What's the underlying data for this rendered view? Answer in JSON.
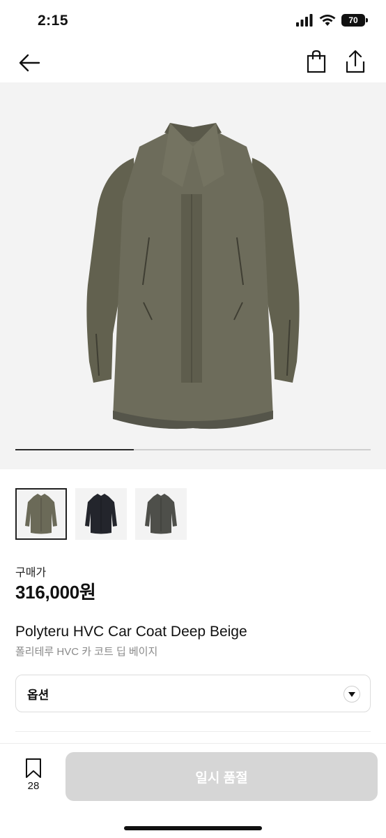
{
  "status_bar": {
    "time": "2:15",
    "battery": "70"
  },
  "product": {
    "image_index": 1,
    "image_count": 3,
    "thumbnails": [
      {
        "color": "#6b6a58",
        "label": "deep-beige"
      },
      {
        "color": "#23252c",
        "label": "black"
      },
      {
        "color": "#4e4f4a",
        "label": "charcoal"
      }
    ],
    "price_label": "구매가",
    "price": "316,000원",
    "title_en": "Polyteru HVC Car Coat Deep Beige",
    "title_kr": "폴리테루 HVC 카 코트 딥 베이지",
    "option_label": "옵션"
  },
  "bottom_bar": {
    "bookmark_count": "28",
    "buy_label": "일시 품절"
  },
  "colors": {
    "coat_main": "#6d6c5b",
    "coat_shadow": "#55554a",
    "button_disabled": "#d6d6d6"
  }
}
